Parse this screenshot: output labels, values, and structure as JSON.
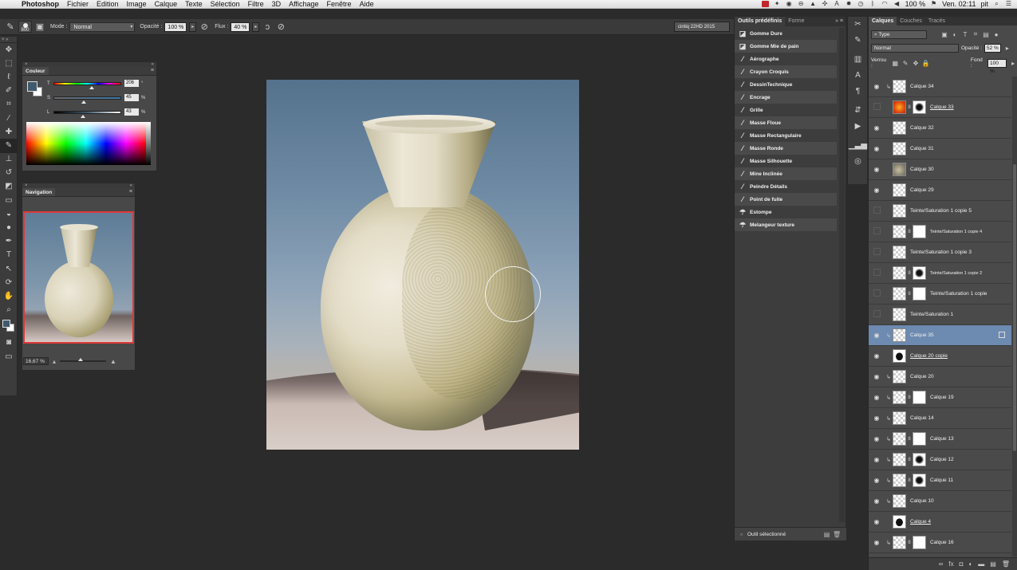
{
  "menubar": {
    "app_name": "Photoshop",
    "items": [
      "Fichier",
      "Edition",
      "Image",
      "Calque",
      "Texte",
      "Sélection",
      "Filtre",
      "3D",
      "Affichage",
      "Fenêtre",
      "Aide"
    ],
    "battery": "100 %",
    "clock": "Ven. 02:11",
    "user": "pit"
  },
  "options_bar": {
    "brush_size": "800",
    "mode_label": "Mode :",
    "mode_value": "Normal",
    "opacity_label": "Opacité :",
    "opacity_value": "100 %",
    "flow_label": "Flux :",
    "flow_value": "40 %",
    "workspace": "cintiq 22HD 2015"
  },
  "color_panel": {
    "title": "Couleur",
    "sliders": [
      {
        "label": "T",
        "value": "206",
        "unit": "°",
        "fraction": 0.57
      },
      {
        "label": "S",
        "value": "45",
        "unit": "%",
        "fraction": 0.45
      },
      {
        "label": "L",
        "value": "43",
        "unit": "%",
        "fraction": 0.43
      }
    ],
    "foreground_color": "#3f5a6d",
    "background_color": "#ffffff"
  },
  "navigation_panel": {
    "title": "Navigation",
    "zoom": "16,67 %",
    "zoom_fraction": 0.45
  },
  "presets_panel": {
    "tabs": [
      "Outils prédéfinis",
      "Forme"
    ],
    "items": [
      {
        "icon": "eraser-icon",
        "label": "Gomme Dure"
      },
      {
        "icon": "eraser-icon",
        "label": "Gomme Mie de pain"
      },
      {
        "icon": "brush-icon",
        "label": "Aérographe"
      },
      {
        "icon": "brush-icon",
        "label": "Crayon Croquis"
      },
      {
        "icon": "brush-icon",
        "label": "DessinTechnique"
      },
      {
        "icon": "brush-icon",
        "label": "Encrage"
      },
      {
        "icon": "brush-icon",
        "label": "Grille"
      },
      {
        "icon": "brush-icon",
        "label": "Masse Floue"
      },
      {
        "icon": "brush-icon",
        "label": "Masse Rectangulaire"
      },
      {
        "icon": "brush-icon",
        "label": "Masse Ronde"
      },
      {
        "icon": "brush-icon",
        "label": "Masse Silhouette"
      },
      {
        "icon": "brush-icon",
        "label": "Mine Inclinée"
      },
      {
        "icon": "brush-icon",
        "label": "Peindre Détails"
      },
      {
        "icon": "brush-icon",
        "label": "Point de fuite"
      },
      {
        "icon": "smudge-icon",
        "label": "Estompe"
      },
      {
        "icon": "smudge-icon",
        "label": "Melangeur texture"
      }
    ],
    "footer": "Outil sélectionné"
  },
  "layers_panel": {
    "tabs": [
      "Calques",
      "Couches",
      "Tracés"
    ],
    "filter": "Type",
    "blend_mode": "Normal",
    "opacity_label": "Opacité :",
    "opacity_value": "52 %",
    "lock_label": "Verrou :",
    "fill_label": "Fond :",
    "fill_value": "100 %",
    "layers": [
      {
        "name": "Calque 34",
        "visible": true,
        "clip": true,
        "thumb": "checker",
        "mask": "none"
      },
      {
        "name": "Calque 33",
        "visible": false,
        "clip": false,
        "thumb": "orange",
        "mask": "maskdark",
        "underline": true
      },
      {
        "name": "Calque 32",
        "visible": true,
        "clip": false,
        "thumb": "checker",
        "mask": "none"
      },
      {
        "name": "Calque 31",
        "visible": true,
        "clip": false,
        "thumb": "checker",
        "mask": "none"
      },
      {
        "name": "Calque 30",
        "visible": true,
        "clip": false,
        "thumb": "vase",
        "mask": "none"
      },
      {
        "name": "Calque 29",
        "visible": true,
        "clip": false,
        "thumb": "checker",
        "mask": "none"
      },
      {
        "name": "Teinte/Saturation 1 copie 5",
        "visible": false,
        "clip": false,
        "thumb": "checker",
        "mask": "none"
      },
      {
        "name": "Teinte/Saturation 1 copie 4",
        "visible": false,
        "clip": false,
        "thumb": "checker",
        "mask": "mask",
        "small": true
      },
      {
        "name": "Teinte/Saturation 1 copie 3",
        "visible": false,
        "clip": false,
        "thumb": "checker",
        "mask": "none"
      },
      {
        "name": "Teinte/Saturation 1 copie 2",
        "visible": false,
        "clip": false,
        "thumb": "checker",
        "mask": "maskdark",
        "small": true
      },
      {
        "name": "Teinte/Saturation 1 copie",
        "visible": false,
        "clip": false,
        "thumb": "checker",
        "mask": "mask"
      },
      {
        "name": "Teinte/Saturation 1",
        "visible": false,
        "clip": false,
        "thumb": "checker",
        "mask": "none"
      },
      {
        "name": "Calque 35",
        "visible": true,
        "clip": true,
        "thumb": "checker",
        "mask": "none",
        "selected": true
      },
      {
        "name": "Calque 20 copie",
        "visible": true,
        "clip": false,
        "thumb": "dark",
        "mask": "none",
        "underline": true
      },
      {
        "name": "Calque 20",
        "visible": true,
        "clip": true,
        "thumb": "checker",
        "mask": "none"
      },
      {
        "name": "Calque 19",
        "visible": true,
        "clip": true,
        "thumb": "checker",
        "mask": "mask"
      },
      {
        "name": "Calque 14",
        "visible": true,
        "clip": true,
        "thumb": "checker",
        "mask": "none"
      },
      {
        "name": "Calque 13",
        "visible": true,
        "clip": true,
        "thumb": "checker",
        "mask": "mask"
      },
      {
        "name": "Calque 12",
        "visible": true,
        "clip": true,
        "thumb": "checker",
        "mask": "maskdark"
      },
      {
        "name": "Calque 11",
        "visible": true,
        "clip": true,
        "thumb": "checker",
        "mask": "maskdark"
      },
      {
        "name": "Calque 10",
        "visible": true,
        "clip": true,
        "thumb": "checker",
        "mask": "none"
      },
      {
        "name": "Calque 4",
        "visible": true,
        "clip": false,
        "thumb": "dark",
        "mask": "none",
        "underline": true
      },
      {
        "name": "Calque 16",
        "visible": true,
        "clip": true,
        "thumb": "checker",
        "mask": "mask"
      }
    ]
  }
}
